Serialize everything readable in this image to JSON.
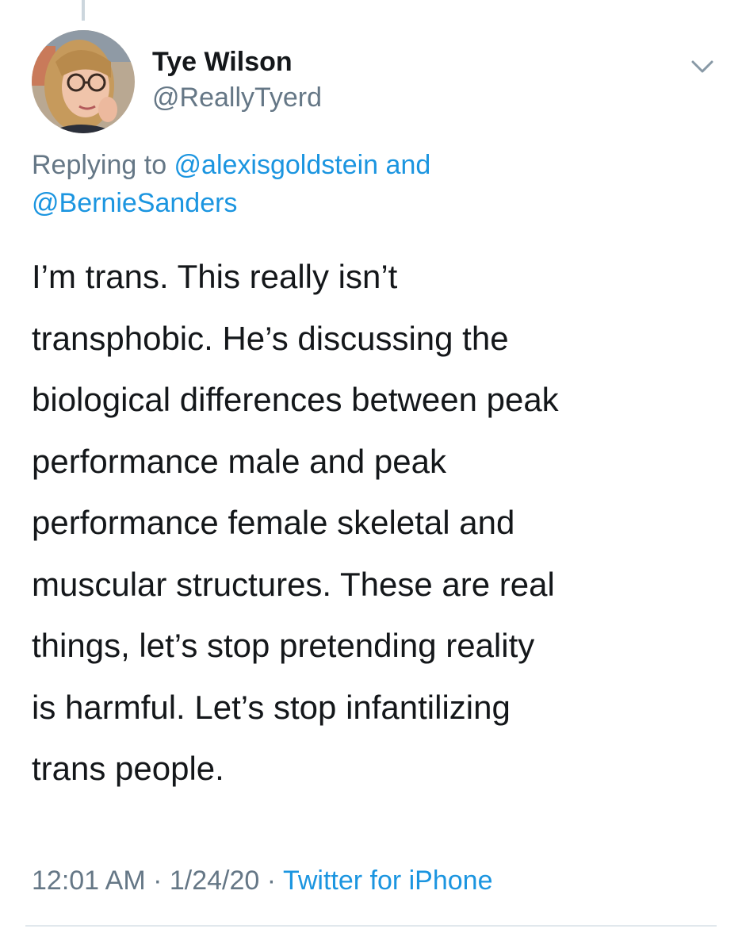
{
  "tweet": {
    "author": {
      "display_name": "Tye Wilson",
      "handle": "@ReallyTyerd"
    },
    "replying": {
      "prefix": "Replying to ",
      "mention_1": "@alexisgoldstein",
      "connector": " and",
      "mention_2": "@BernieSanders"
    },
    "text_lines": [
      "I’m trans. This really isn’t",
      "transphobic. He’s discussing the",
      "biological differences between peak",
      "performance male and peak",
      "performance female skeletal and",
      "muscular structures. These are real",
      "things, let’s stop pretending reality",
      "is harmful. Let’s stop infantilizing",
      "trans people."
    ],
    "meta": {
      "time": "12:01 AM",
      "sep1": " · ",
      "date": "1/24/20",
      "sep2": " · ",
      "source": "Twitter for iPhone"
    }
  },
  "icons": {
    "caret": "chevron-down-icon",
    "avatar": "profile-photo"
  },
  "colors": {
    "text": "#14171a",
    "secondary": "#657786",
    "link": "#1b95e0",
    "divider": "#e1e8ed"
  }
}
